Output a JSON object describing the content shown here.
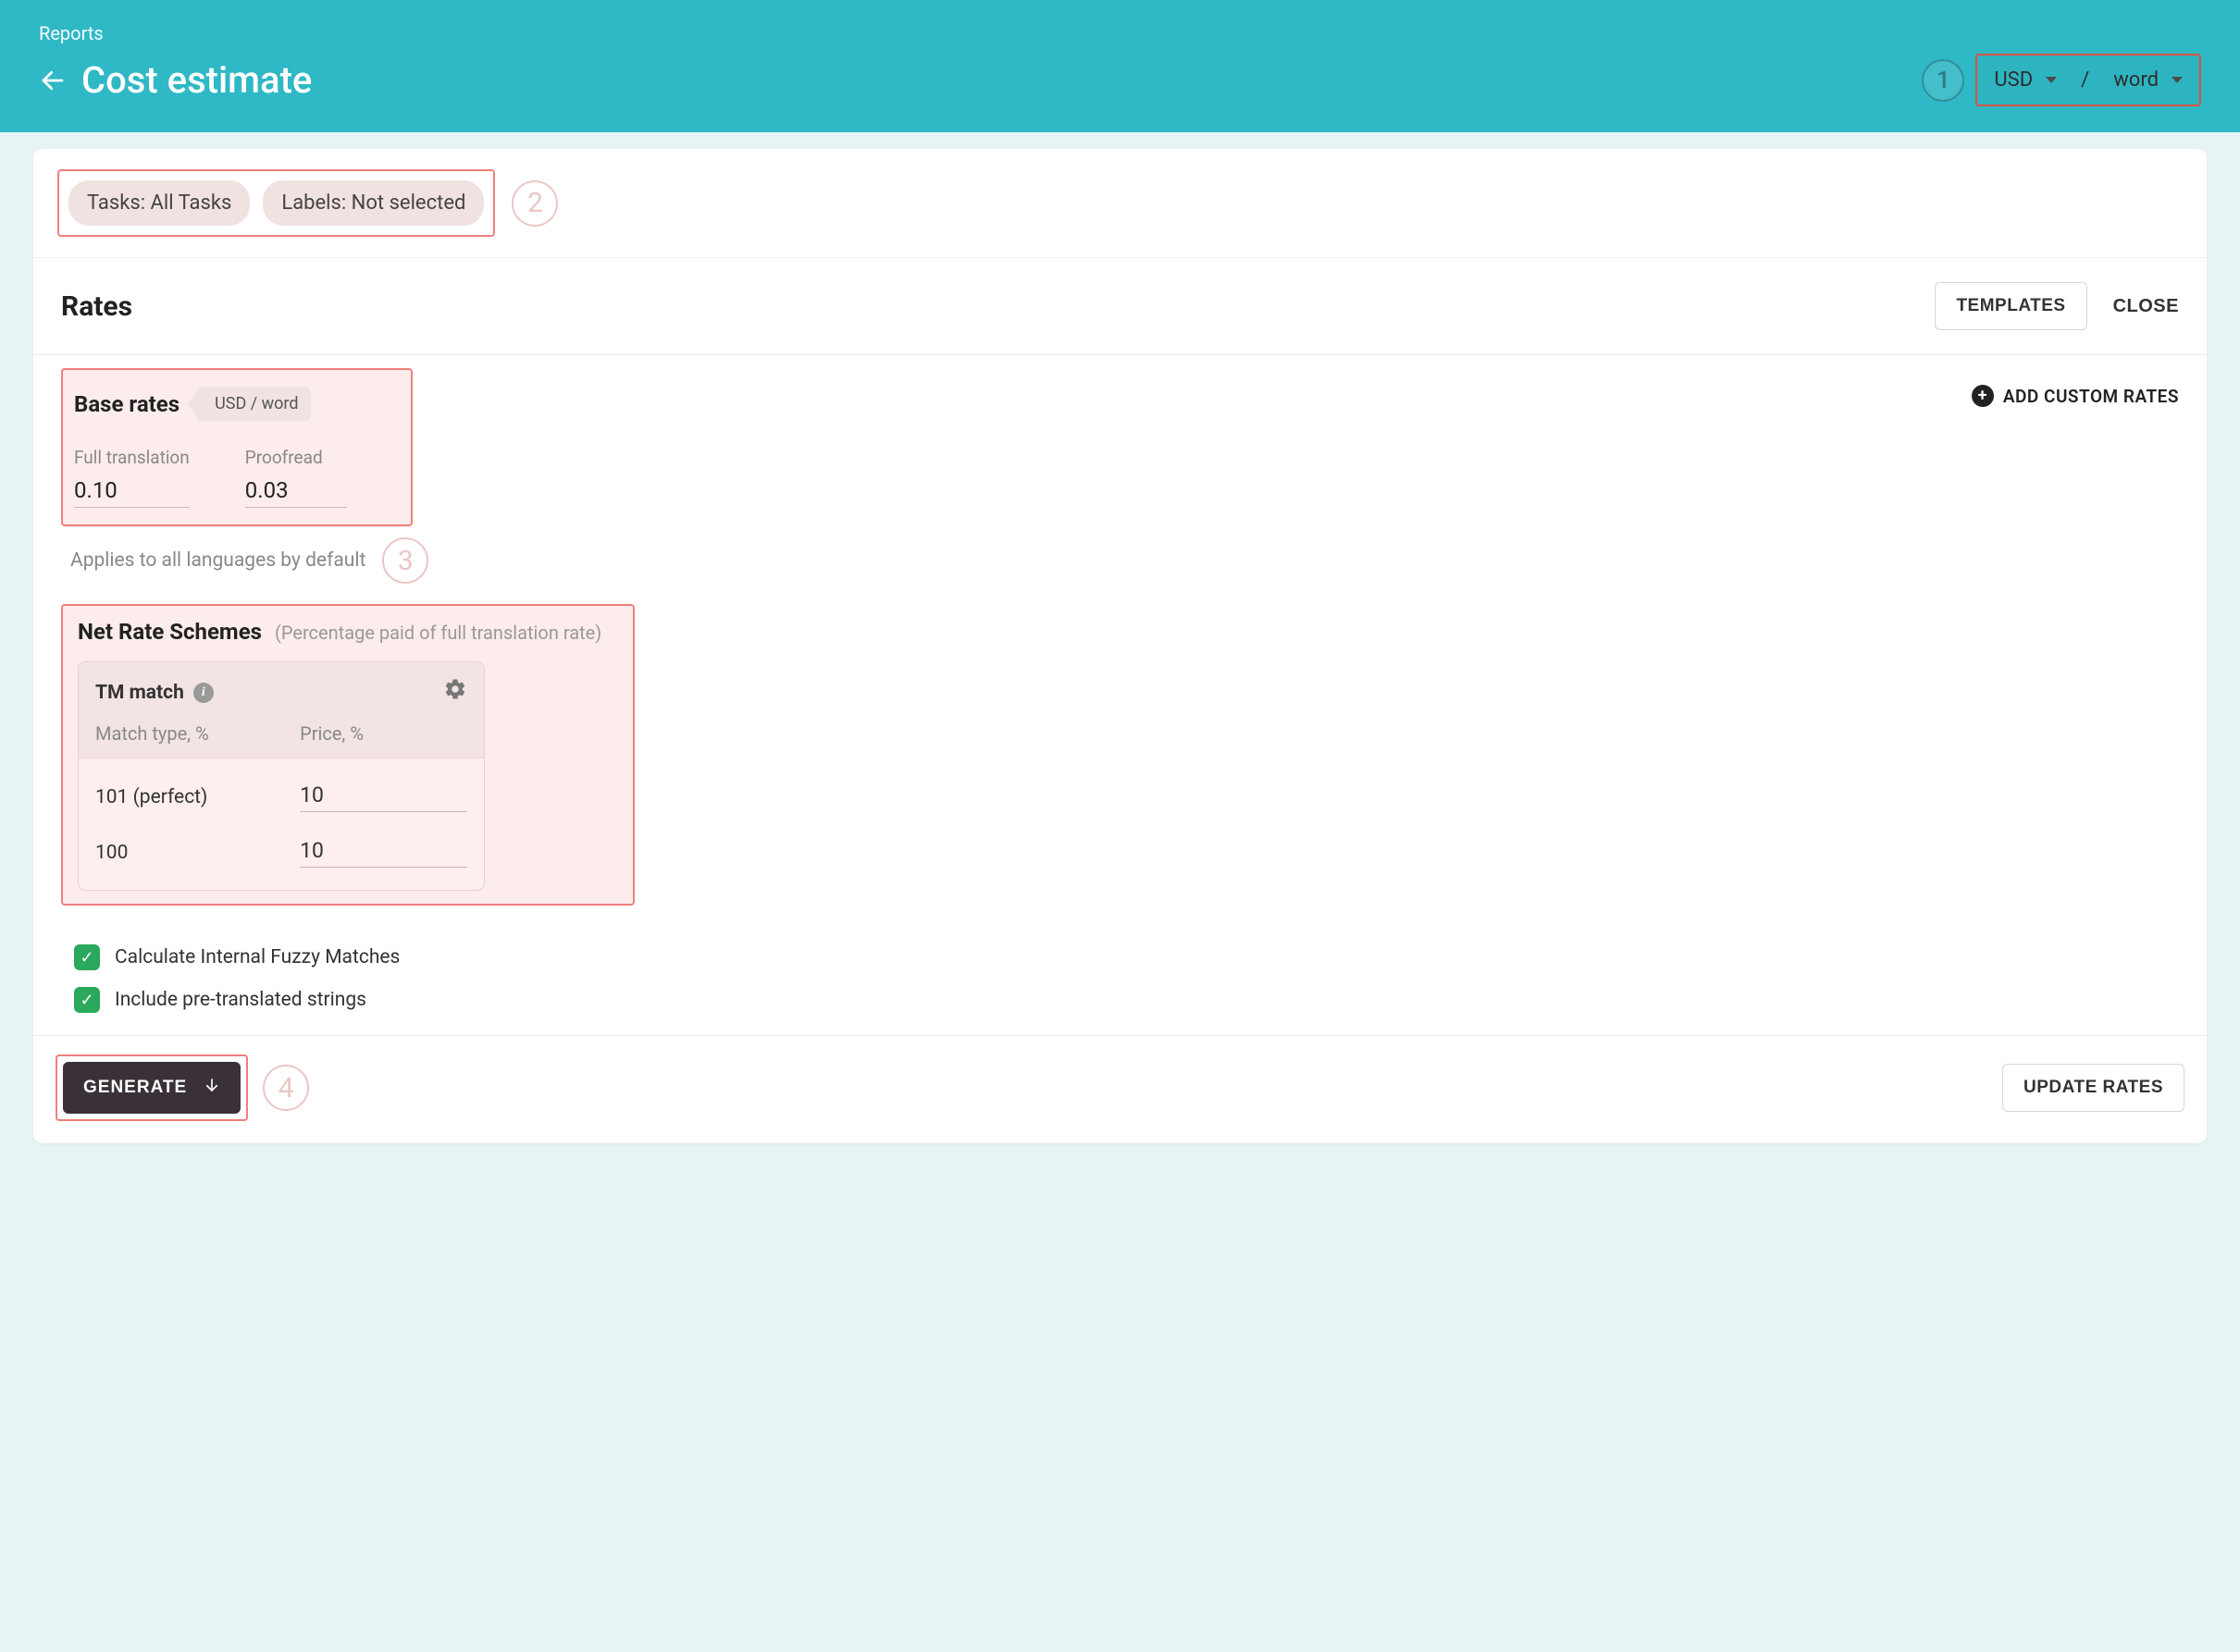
{
  "breadcrumb": "Reports",
  "page_title": "Cost estimate",
  "step_labels": {
    "one": "1",
    "two": "2",
    "three": "3",
    "four": "4"
  },
  "currency_selector": {
    "currency": "USD",
    "divider": "/",
    "unit": "word"
  },
  "filters": {
    "tasks_chip": "Tasks: All Tasks",
    "labels_chip": "Labels: Not selected"
  },
  "rates_header": {
    "title": "Rates",
    "templates_btn": "TEMPLATES",
    "close_btn": "CLOSE"
  },
  "base_rates": {
    "title": "Base rates",
    "unit_tag": "USD / word",
    "cols": [
      {
        "label": "Full translation",
        "value": "0.10"
      },
      {
        "label": "Proofread",
        "value": "0.03"
      }
    ],
    "applies_note": "Applies to all languages by default",
    "add_custom": "ADD CUSTOM RATES"
  },
  "nrs": {
    "title": "Net Rate Schemes",
    "subtitle": "(Percentage paid of full translation rate)",
    "tm": {
      "title": "TM match",
      "col_match": "Match type, %",
      "col_price": "Price, %",
      "rows": [
        {
          "match": "101 (perfect)",
          "price": "10"
        },
        {
          "match": "100",
          "price": "10"
        }
      ]
    }
  },
  "options": {
    "fuzzy": "Calculate Internal Fuzzy Matches",
    "pretranslated": "Include pre-translated strings"
  },
  "footer": {
    "generate": "GENERATE",
    "update": "UPDATE RATES"
  },
  "icons": {
    "checkmark": "✓",
    "plus": "+",
    "info": "i"
  }
}
